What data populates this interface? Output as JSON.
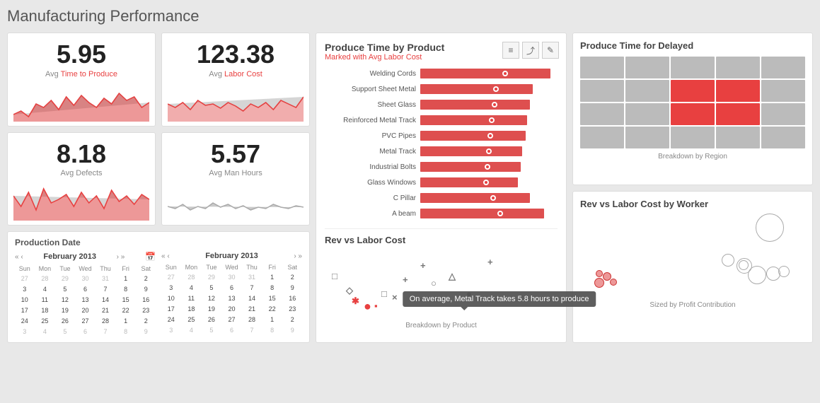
{
  "page": {
    "title": "Manufacturing Performance"
  },
  "kpis": [
    {
      "id": "avg-time",
      "value": "5.95",
      "label": "Avg ",
      "highlight": "Time to Produce",
      "suffix": ""
    },
    {
      "id": "avg-labor",
      "value": "123.38",
      "label": "Avg ",
      "highlight": "Labor Cost",
      "suffix": ""
    },
    {
      "id": "avg-defects",
      "value": "8.18",
      "label": "Avg Defects",
      "highlight": "",
      "suffix": ""
    },
    {
      "id": "avg-manhours",
      "value": "5.57",
      "label": "Avg Man Hours",
      "highlight": "",
      "suffix": ""
    }
  ],
  "bar_chart": {
    "title": "Produce Time by Product",
    "subtitle": "Marked with Avg Labor Cost",
    "tooltip": "On average, Metal Track takes 5.8 hours to produce",
    "tooltip_target": "Metal Track",
    "bars": [
      {
        "label": "Welding Cords",
        "bg_pct": 95,
        "red_pct": 95,
        "marker_pct": 62
      },
      {
        "label": "Support Sheet Metal",
        "bg_pct": 82,
        "red_pct": 82,
        "marker_pct": 55
      },
      {
        "label": "Sheet Glass",
        "bg_pct": 80,
        "red_pct": 80,
        "marker_pct": 54
      },
      {
        "label": "Reinforced Metal Track",
        "bg_pct": 78,
        "red_pct": 78,
        "marker_pct": 52
      },
      {
        "label": "PVC Pipes",
        "bg_pct": 77,
        "red_pct": 77,
        "marker_pct": 51
      },
      {
        "label": "Metal Track",
        "bg_pct": 74,
        "red_pct": 74,
        "marker_pct": 50
      },
      {
        "label": "Industrial Bolts",
        "bg_pct": 73,
        "red_pct": 73,
        "marker_pct": 49
      },
      {
        "label": "Glass Windows",
        "bg_pct": 71,
        "red_pct": 71,
        "marker_pct": 48
      },
      {
        "label": "C Pillar",
        "bg_pct": 80,
        "red_pct": 80,
        "marker_pct": 53
      },
      {
        "label": "A beam",
        "bg_pct": 90,
        "red_pct": 90,
        "marker_pct": 58
      }
    ]
  },
  "produce_time_delayed": {
    "title": "Produce Time for Delayed",
    "label": "Breakdown by Region"
  },
  "rev_labor_worker": {
    "title": "Rev vs Labor Cost by Worker",
    "label": "Sized by Profit Contribution"
  },
  "rev_labor_product": {
    "title": "Rev vs Labor Cost",
    "label": "Breakdown by Product"
  },
  "calendar": {
    "title": "Production Date",
    "calendars": [
      {
        "month": "February 2013",
        "days_header": [
          "Sun",
          "Mon",
          "Tue",
          "Wed",
          "Thu",
          "Fri",
          "Sat"
        ],
        "weeks": [
          [
            "27",
            "28",
            "29",
            "30",
            "31",
            "1",
            "2"
          ],
          [
            "3",
            "4",
            "5",
            "6",
            "7",
            "8",
            "9"
          ],
          [
            "10",
            "11",
            "12",
            "13",
            "14",
            "15",
            "16"
          ],
          [
            "17",
            "18",
            "19",
            "20",
            "21",
            "22",
            "23"
          ],
          [
            "24",
            "25",
            "26",
            "27",
            "28",
            "1",
            "2"
          ],
          [
            "3",
            "4",
            "5",
            "6",
            "7",
            "8",
            "9"
          ]
        ],
        "other_month_days": [
          "27",
          "28",
          "29",
          "30",
          "31",
          "1",
          "2",
          "3",
          "4",
          "5",
          "6",
          "7",
          "8",
          "9"
        ]
      },
      {
        "month": "February 2013",
        "days_header": [
          "Sun",
          "Mon",
          "Tue",
          "Wed",
          "Thu",
          "Fri",
          "Sat"
        ],
        "weeks": [
          [
            "27",
            "28",
            "29",
            "30",
            "31",
            "1",
            "2"
          ],
          [
            "3",
            "4",
            "5",
            "6",
            "7",
            "8",
            "9"
          ],
          [
            "10",
            "11",
            "12",
            "13",
            "14",
            "15",
            "16"
          ],
          [
            "17",
            "18",
            "19",
            "20",
            "21",
            "22",
            "23"
          ],
          [
            "24",
            "25",
            "26",
            "27",
            "28",
            "1",
            "2"
          ],
          [
            "3",
            "4",
            "5",
            "6",
            "7",
            "8",
            "9"
          ]
        ],
        "other_month_days": [
          "27",
          "28",
          "29",
          "30",
          "31",
          "1",
          "2",
          "3",
          "4",
          "5",
          "6",
          "7",
          "8",
          "9"
        ]
      }
    ]
  },
  "buttons": {
    "chart_legend": "≡",
    "chart_expand": "⤢",
    "chart_edit": "✏"
  }
}
